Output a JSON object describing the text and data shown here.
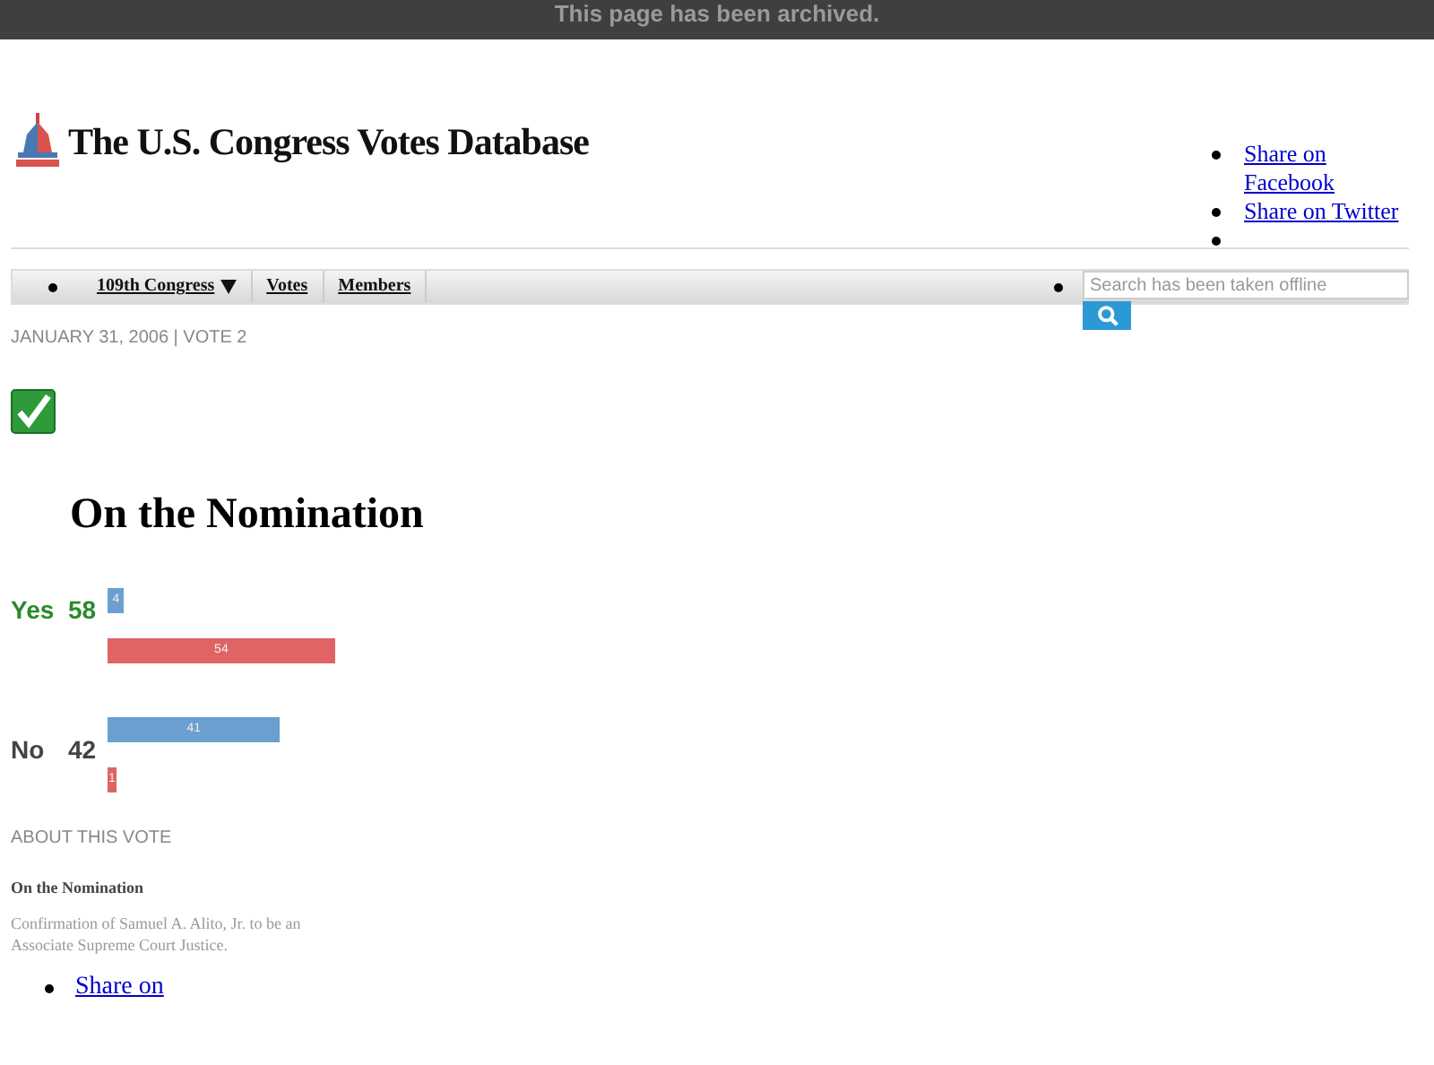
{
  "banner": "This page has been archived.",
  "site_title": "The U.S. Congress Votes Database",
  "share_links": [
    "Share on Facebook",
    "Share on Twitter"
  ],
  "nav": [
    {
      "label": "109th Congress",
      "dropdown": true
    },
    {
      "label": "Votes",
      "dropdown": false
    },
    {
      "label": "Members",
      "dropdown": false
    }
  ],
  "search": {
    "placeholder": "Search has been taken offline"
  },
  "dateline": "JANUARY 31, 2006 | VOTE 2",
  "passed": true,
  "heading": "On the Nomination",
  "results": [
    {
      "label": "Yes",
      "count": "58",
      "kind": "yes",
      "bars": [
        {
          "color": "#6a9fcf",
          "label": "4"
        },
        {
          "color": "#e06464",
          "label": "54"
        }
      ]
    },
    {
      "label": "No",
      "count": "42",
      "kind": "no",
      "bars": [
        {
          "color": "#6a9fcf",
          "label": "41"
        },
        {
          "color": "#e06464",
          "label": "1"
        }
      ]
    }
  ],
  "about": {
    "heading": "ABOUT THIS VOTE",
    "title": "On the Nomination",
    "description": "Confirmation of Samuel A. Alito, Jr. to be an Associate Supreme Court Justice."
  },
  "footer_share": "Share on"
}
